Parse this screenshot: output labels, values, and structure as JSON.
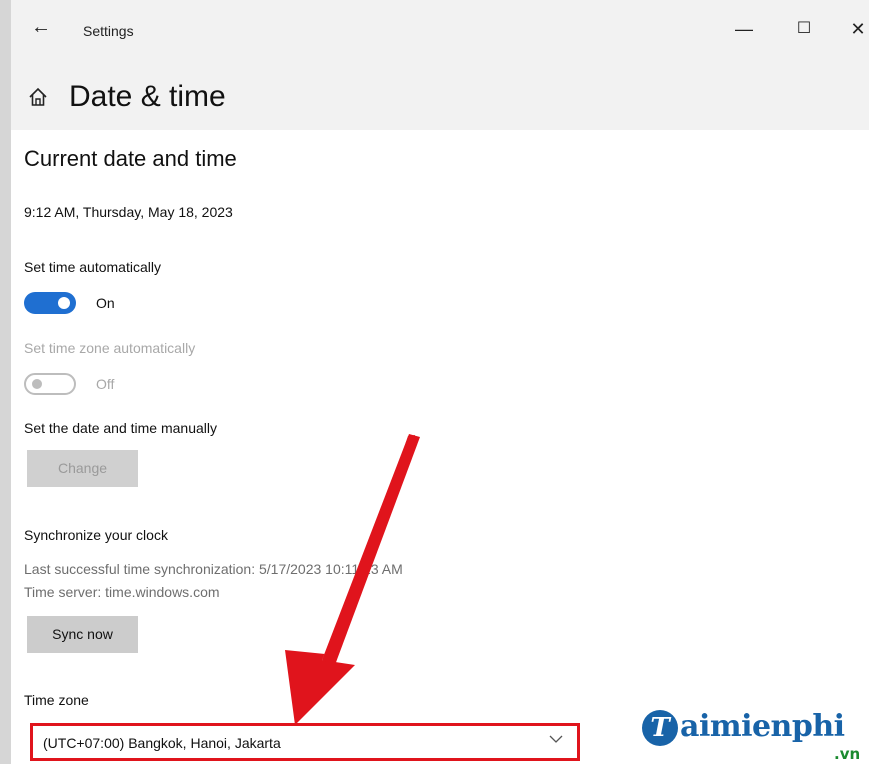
{
  "window": {
    "app_title": "Settings",
    "back_icon": "back-arrow-icon",
    "min_glyph": "—",
    "max_glyph": "☐",
    "close_glyph": "✕"
  },
  "page": {
    "title": "Date & time",
    "home_icon": "home-icon"
  },
  "current_section": {
    "title": "Current date and time",
    "current_datetime": "9:12 AM, Thursday, May 18, 2023"
  },
  "set_time_auto": {
    "label": "Set time automatically",
    "state": "On",
    "enabled": true
  },
  "set_timezone_auto": {
    "label": "Set time zone automatically",
    "state": "Off",
    "enabled": false
  },
  "manual": {
    "label": "Set the date and time manually",
    "button_label": "Change"
  },
  "sync": {
    "label": "Synchronize your clock",
    "last_sync": "Last successful time synchronization: 5/17/2023 10:11:13 AM",
    "server": "Time server: time.windows.com",
    "button_label": "Sync now"
  },
  "timezone": {
    "label": "Time zone",
    "selected": "(UTC+07:00) Bangkok, Hanoi, Jakarta"
  },
  "annotation": {
    "arrow_color": "#e0141c",
    "highlight_color": "#e0141c"
  },
  "watermark": {
    "mark": "T",
    "text": "aimienphi",
    "suffix": ".vn"
  },
  "colors": {
    "accent": "#1f6fd1",
    "header_bg": "#f2f2f2"
  }
}
